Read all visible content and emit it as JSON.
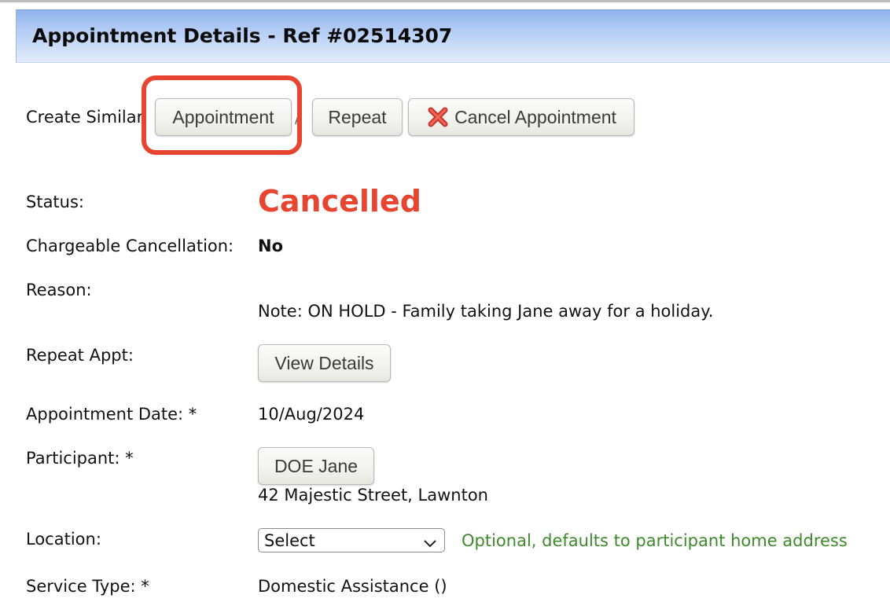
{
  "header": {
    "title": "Appointment Details - Ref #02514307"
  },
  "actions": {
    "create_similar_label": "Create Similar",
    "appointment_button": "Appointment",
    "separator": "/",
    "repeat_button": "Repeat",
    "cancel_button": "Cancel Appointment"
  },
  "fields": {
    "status_label": "Status:",
    "status_value": "Cancelled",
    "chargeable_label": "Chargeable Cancellation:",
    "chargeable_value": "No",
    "reason_label": "Reason:",
    "reason_value": "Note: ON HOLD - Family taking Jane away for a holiday.",
    "repeat_label": "Repeat Appt:",
    "view_details_button": "View Details",
    "date_label": "Appointment Date: *",
    "date_value": "10/Aug/2024",
    "participant_label": "Participant: *",
    "participant_button": "DOE Jane",
    "participant_address": "42 Majestic Street, Lawnton",
    "location_label": "Location:",
    "location_select_value": "Select",
    "location_hint": "Optional, defaults to participant home address",
    "service_label": "Service Type: *",
    "service_value": "Domestic Assistance ()"
  },
  "colors": {
    "status_cancelled": "#e84530",
    "highlight": "#e84530",
    "hint_text": "#3d8a2b",
    "header_gradient_top": "#8fb4ec"
  },
  "icons": {
    "cancel": "red-x-icon",
    "select": "chevron-down-icon"
  }
}
